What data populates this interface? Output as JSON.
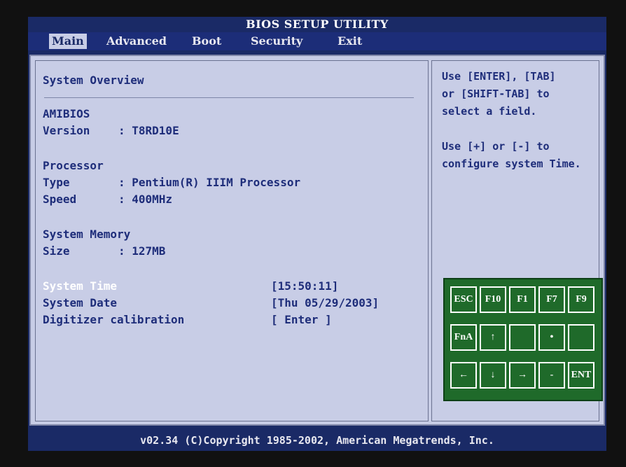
{
  "title": "BIOS SETUP UTILITY",
  "menu": {
    "items": [
      {
        "label": "Main",
        "active": true
      },
      {
        "label": "Advanced",
        "active": false
      },
      {
        "label": "Boot",
        "active": false
      },
      {
        "label": "Security",
        "active": false
      },
      {
        "label": "Exit",
        "active": false
      }
    ]
  },
  "main": {
    "section_title": "System Overview",
    "amibios": {
      "heading": "AMIBIOS",
      "version_label": "Version",
      "version_value": ": T8RD10E"
    },
    "processor": {
      "heading": "Processor",
      "type_label": "Type",
      "type_value": ": Pentium(R) IIIM Processor",
      "speed_label": "Speed",
      "speed_value": ": 400MHz"
    },
    "memory": {
      "heading": "System Memory",
      "size_label": "Size",
      "size_value": ": 127MB"
    },
    "fields": [
      {
        "label": "System Time",
        "value": "[15:50:11]"
      },
      {
        "label": "System Date",
        "value": "[Thu 05/29/2003]"
      },
      {
        "label": "Digitizer calibration",
        "value": "[ Enter ]"
      }
    ]
  },
  "help": {
    "text": "Use [ENTER], [TAB]\nor [SHIFT-TAB] to\nselect a field.\n\nUse [+] or [-] to\nconfigure system Time."
  },
  "keypad": {
    "rows": [
      [
        "ESC",
        "F10",
        "F1",
        "F7",
        "F9"
      ],
      [
        "FnA",
        "↑",
        "",
        "•",
        ""
      ],
      [
        "←",
        "↓",
        "→",
        "-",
        "ENT"
      ]
    ]
  },
  "footer": "v02.34 (C)Copyright 1985-2002, American Megatrends, Inc.",
  "colors": {
    "background": "#1a2a66",
    "panel": "#c8cde6",
    "text": "#1e2d7a",
    "highlight": "#ffffff",
    "keypad": "#1f6a2a"
  }
}
